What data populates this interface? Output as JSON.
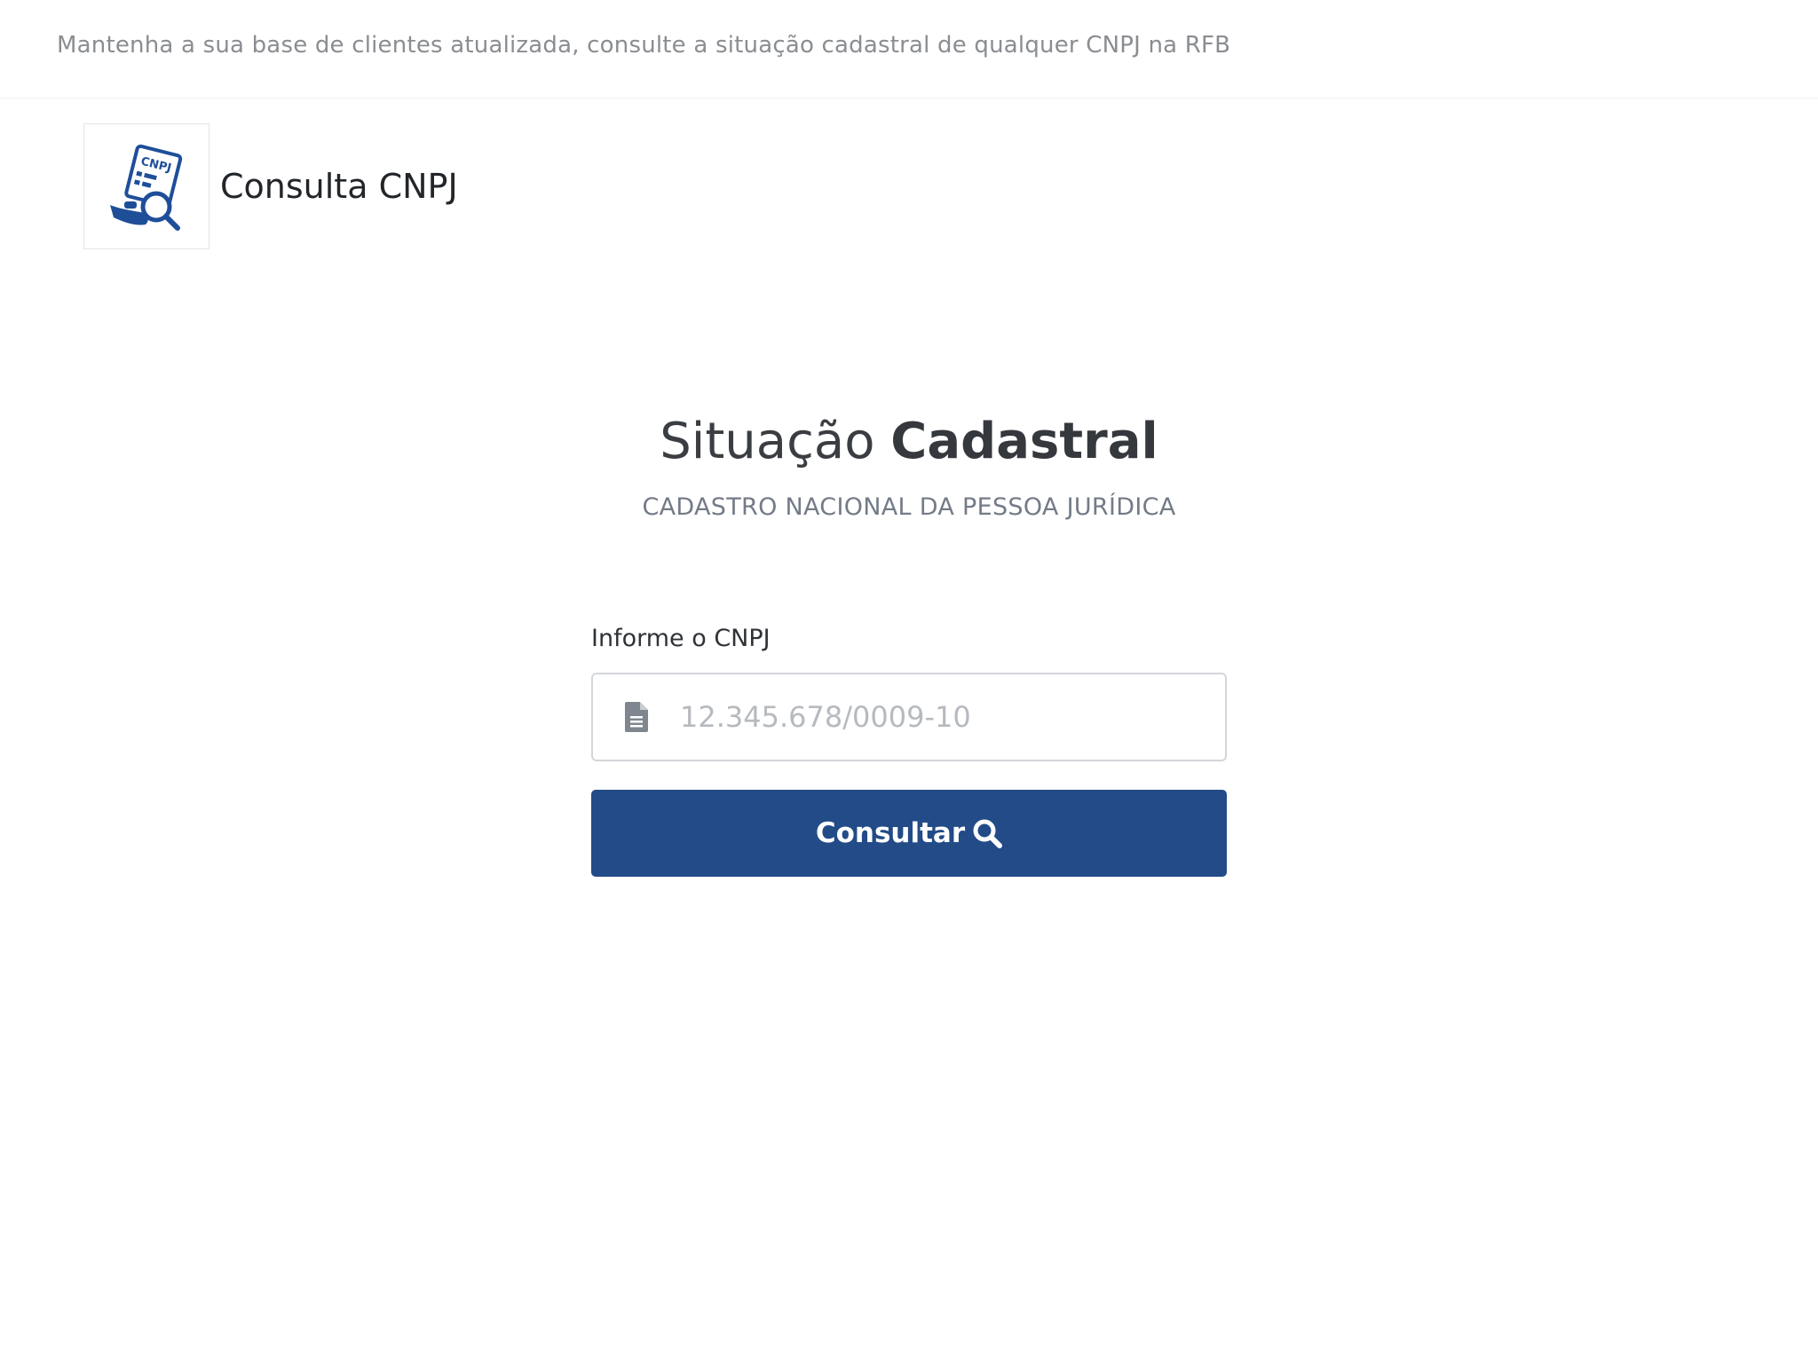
{
  "header": {
    "tagline": "Mantenha a sua base de clientes atualizada, consulte a situação cadastral de qualquer CNPJ na RFB"
  },
  "brand": {
    "logo_text": "CNPJ",
    "name": "Consulta CNPJ"
  },
  "hero": {
    "title_regular": "Situação ",
    "title_bold": "Cadastral",
    "subtitle": "CADASTRO NACIONAL DA PESSOA JURÍDICA"
  },
  "form": {
    "label": "Informe o CNPJ",
    "input_value": "",
    "input_placeholder": "12.345.678/0009-10",
    "submit_label": "Consultar",
    "input_icon": "document-icon",
    "submit_icon": "search-icon"
  },
  "colors": {
    "brand_blue": "#224b87",
    "logo_blue": "#1f4e99"
  }
}
